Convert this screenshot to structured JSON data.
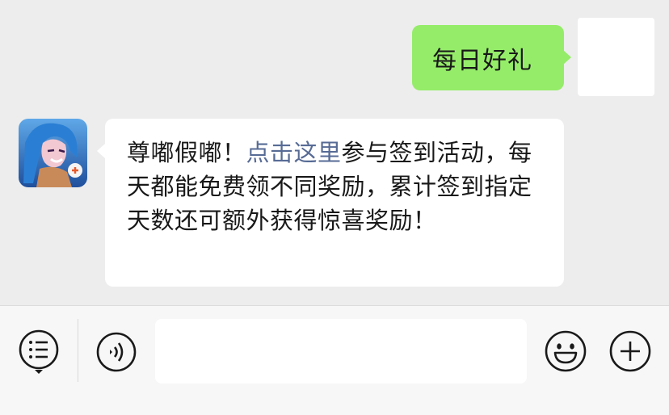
{
  "messages": [
    {
      "direction": "out",
      "text": "每日好礼"
    },
    {
      "direction": "in",
      "text_before": "尊嘟假嘟！",
      "link": "点击这里",
      "text_after": "参与签到活动，每天都能免费领不同奖励，累计签到指定天数还可额外获得惊喜奖励！"
    }
  ],
  "colors": {
    "chat_background": "#ededed",
    "outgoing_bubble": "#95ec69",
    "incoming_bubble": "#ffffff",
    "link": "#576b95",
    "input_bar": "#f7f7f7",
    "icon_stroke": "#1a1a1a"
  },
  "input_bar": {
    "icons": [
      "menu-list-icon",
      "voice-icon",
      "emoji-icon",
      "plus-icon"
    ],
    "input_value": ""
  }
}
